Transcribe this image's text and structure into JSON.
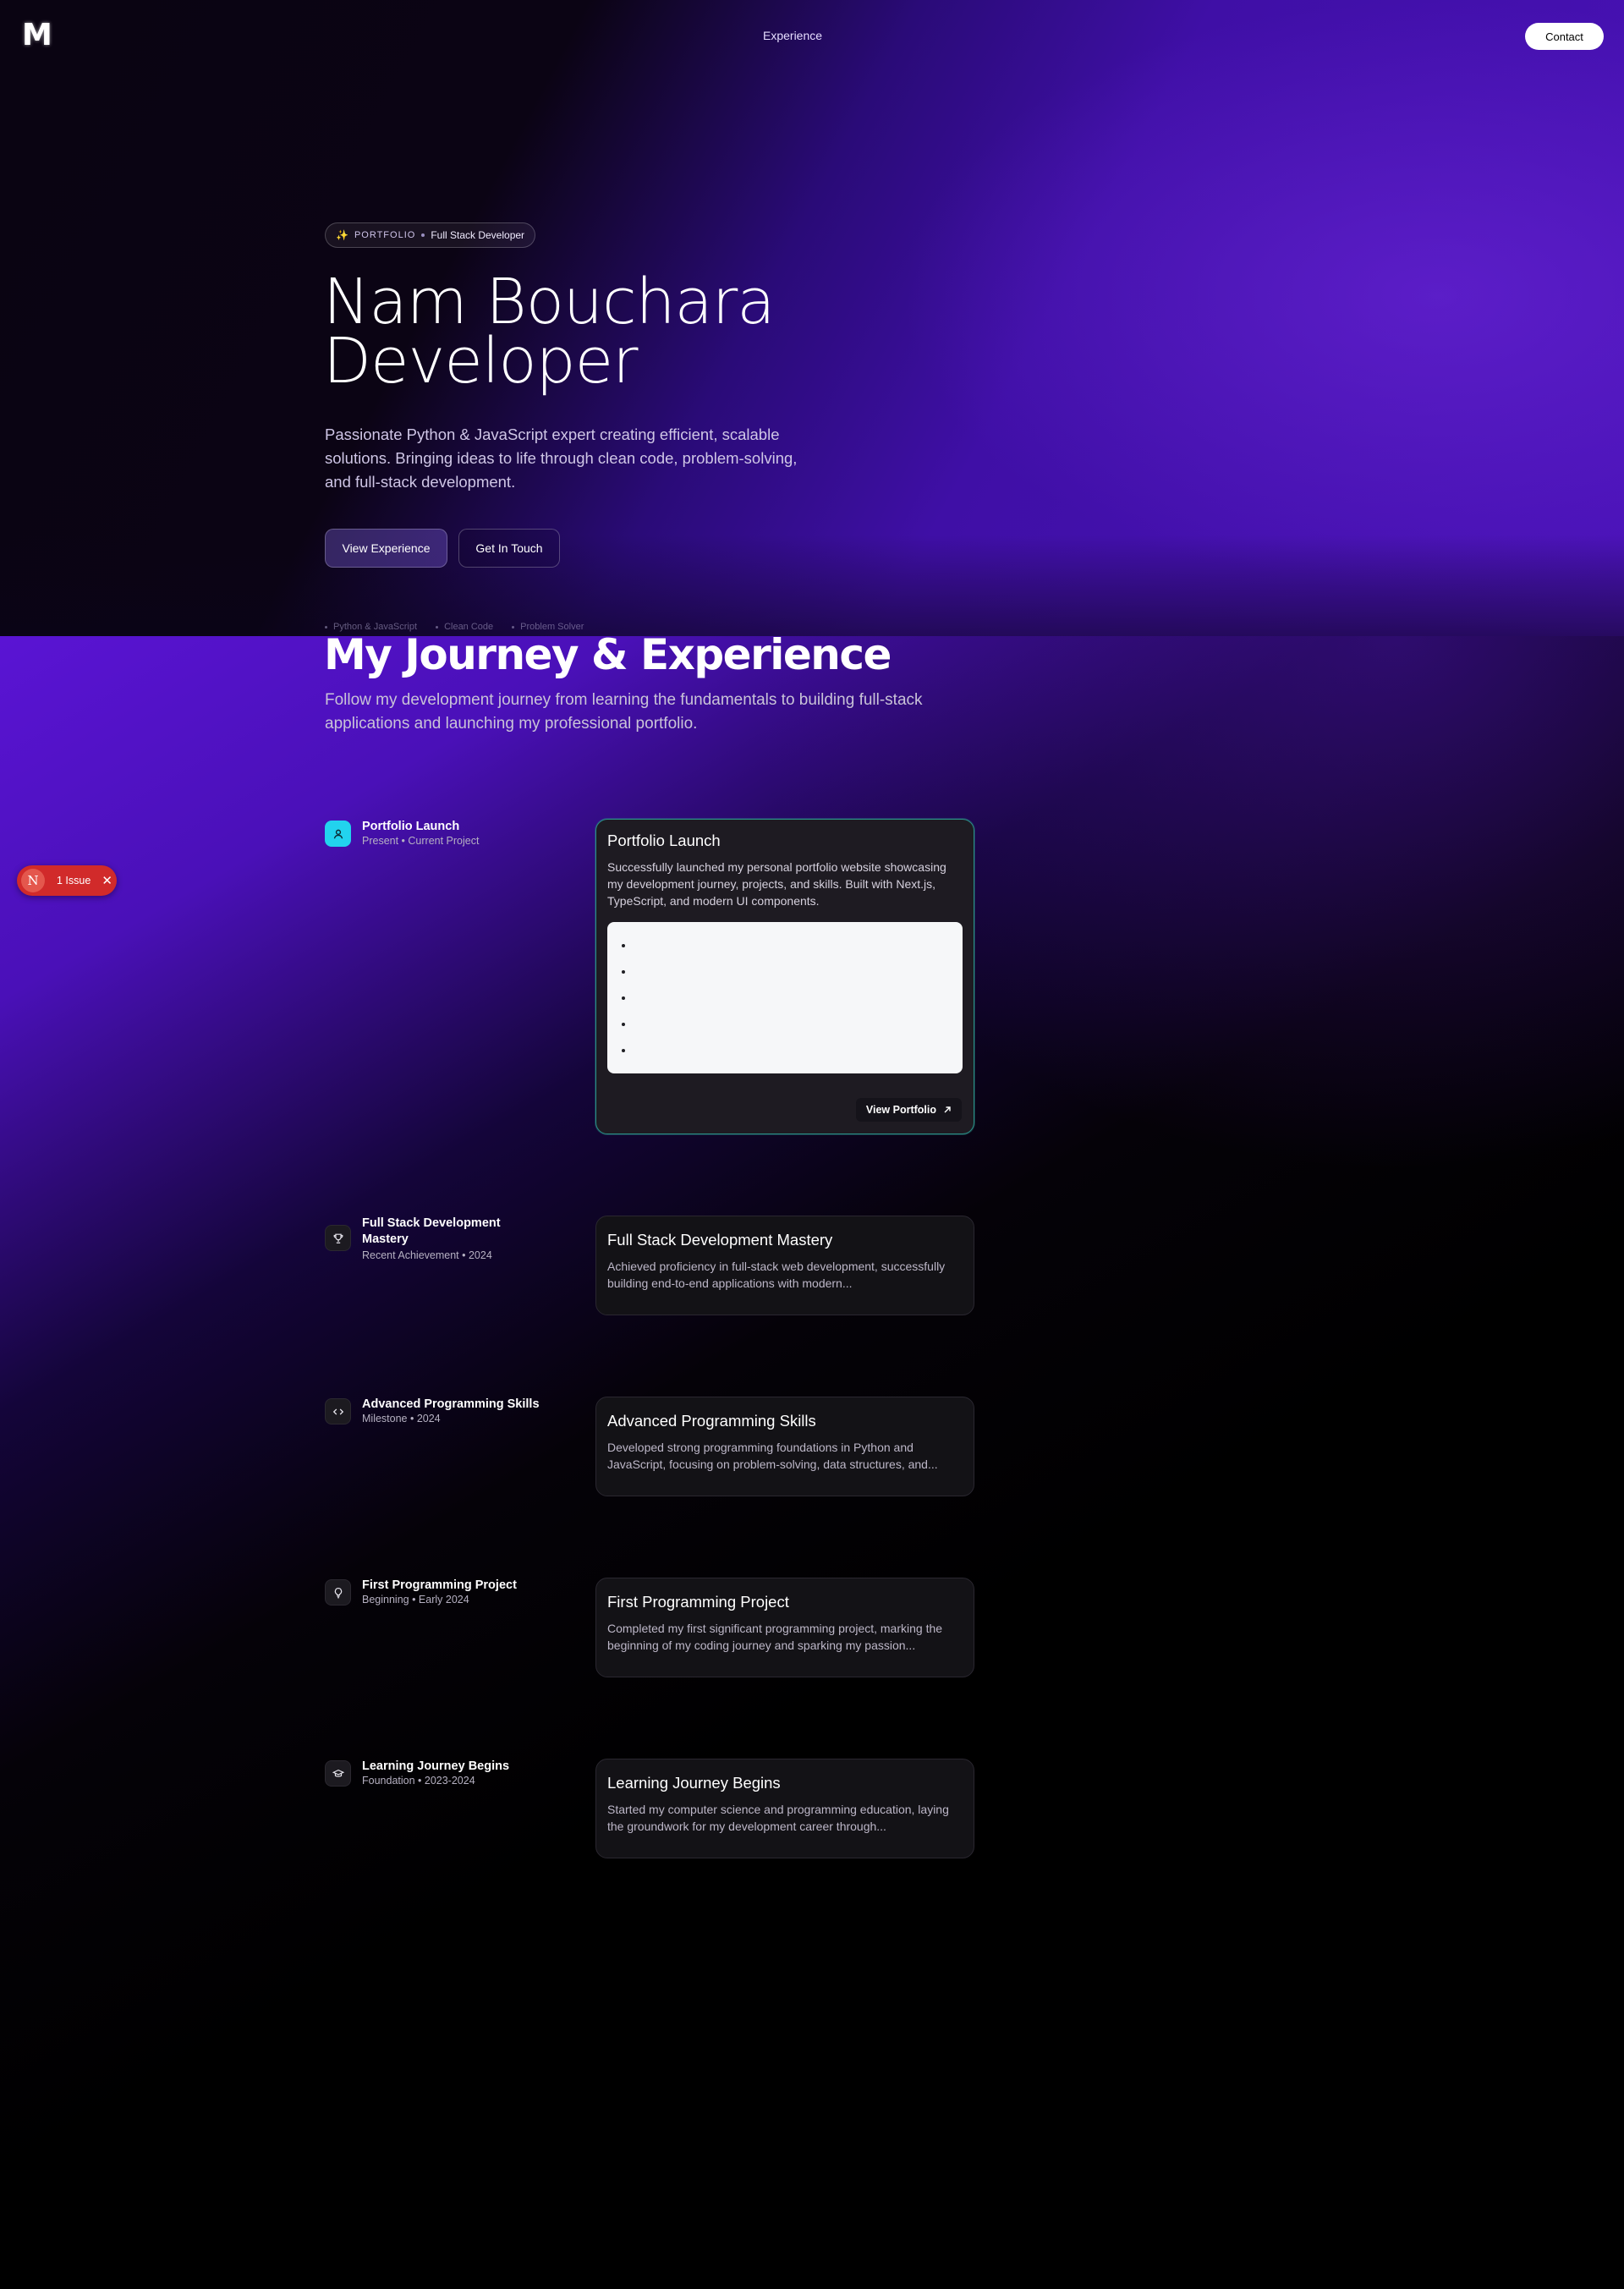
{
  "nav": {
    "logo": "M",
    "link": "Experience",
    "contact": "Contact"
  },
  "hero": {
    "pill_tag": "PORTFOLIO",
    "pill_role": "Full Stack Developer",
    "title_line1": "Nam Bouchara",
    "title_line2": "Developer",
    "description": "Passionate Python & JavaScript expert creating efficient, scalable solutions. Bringing ideas to life through clean code, problem-solving, and full-stack development.",
    "primary_button": "View Experience",
    "secondary_button": "Get In Touch",
    "skills": [
      "Python & JavaScript",
      "Clean Code",
      "Problem Solver"
    ]
  },
  "journey": {
    "title": "My Journey & Experience",
    "description": "Follow my development journey from learning the fundamentals to building full-stack applications and launching my professional portfolio.",
    "items": [
      {
        "title": "Portfolio Launch",
        "meta": "Present • Current Project",
        "icon": "user-icon",
        "card_title": "Portfolio Launch",
        "card_desc": "Successfully launched my personal portfolio website showcasing my development journey, projects, and skills. Built with Next.js, TypeScript, and modern UI components.",
        "link_label": "View Portfolio"
      },
      {
        "title": "Full Stack Development Mastery",
        "meta": "Recent Achievement • 2024",
        "icon": "trophy-icon",
        "card_title": "Full Stack Development Mastery",
        "card_desc": "Achieved proficiency in full-stack web development, successfully building end-to-end applications with modern..."
      },
      {
        "title": "Advanced Programming Skills",
        "meta": "Milestone • 2024",
        "icon": "code-icon",
        "card_title": "Advanced Programming Skills",
        "card_desc": "Developed strong programming foundations in Python and JavaScript, focusing on problem-solving, data structures, and..."
      },
      {
        "title": "First Programming Project",
        "meta": "Beginning • Early 2024",
        "icon": "lightbulb-icon",
        "card_title": "First Programming Project",
        "card_desc": "Completed my first significant programming project, marking the beginning of my coding journey and sparking my passion..."
      },
      {
        "title": "Learning Journey Begins",
        "meta": "Foundation • 2023-2024",
        "icon": "graduation-cap-icon",
        "card_title": "Learning Journey Begins",
        "card_desc": "Started my computer science and programming education, laying the groundwork for my development career through..."
      }
    ]
  },
  "dev_overlay": {
    "logo": "N",
    "issues": "1 Issue"
  },
  "colors": {
    "accent_cyan": "#22d3ee",
    "hero_purple": "#4a12b8",
    "issue_red": "#d12a2a",
    "active_border": "#2b8f86"
  }
}
